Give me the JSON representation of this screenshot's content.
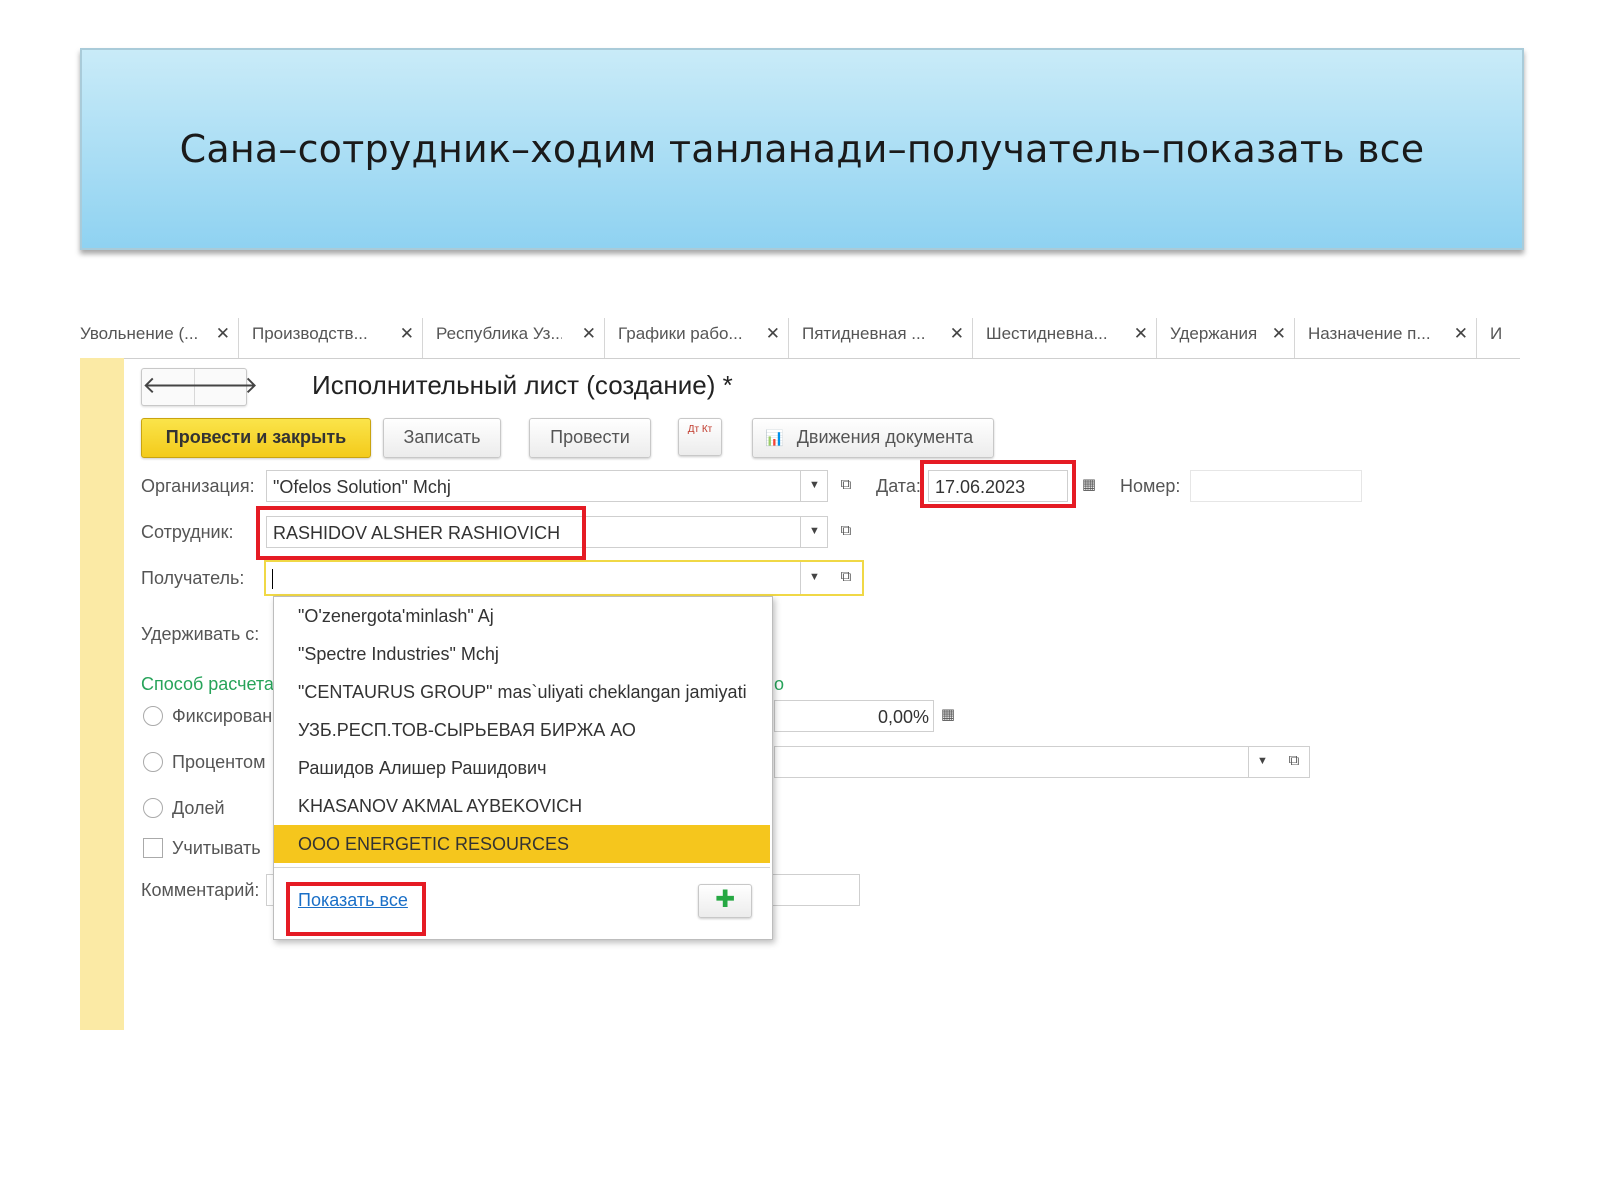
{
  "banner": {
    "text": "Сана–сотрудник–ходим танланади–получатель–показать все"
  },
  "tabs": [
    {
      "label": "Увольнение (..."
    },
    {
      "label": "Производств..."
    },
    {
      "label": "Республика Уз..."
    },
    {
      "label": "Графики рабо..."
    },
    {
      "label": "Пятидневная ..."
    },
    {
      "label": "Шестидневна..."
    },
    {
      "label": "Удержания"
    },
    {
      "label": "Назначение п..."
    },
    {
      "label": "И"
    }
  ],
  "tab_close_glyph": "✕",
  "nav": {
    "back": "🡐",
    "forward": "🡒"
  },
  "document": {
    "title": "Исполнительный лист (создание) *"
  },
  "toolbar": {
    "post_close": "Провести и закрыть",
    "save": "Записать",
    "post": "Провести",
    "dtkt": "Дт Кт",
    "movements": "Движения документа",
    "movements_icon": "📊"
  },
  "form": {
    "organization": {
      "label": "Организация:",
      "value": "\"Ofelos Solution\" Mchj"
    },
    "date": {
      "label": "Дата:",
      "value": "17.06.2023"
    },
    "number": {
      "label": "Номер:",
      "value": ""
    },
    "employee": {
      "label": "Сотрудник:",
      "value": "RASHIDOV ALSHER RASHIOVICH"
    },
    "recipient": {
      "label": "Получатель:",
      "value": ""
    },
    "withhold_from": {
      "label": "Удерживать с:"
    },
    "calc_method": {
      "label": "Способ расчета",
      "label_right": "о"
    },
    "fixed": {
      "label": "Фиксирован"
    },
    "percent_radio": {
      "label": "Процентом"
    },
    "share": {
      "label": "Долей"
    },
    "consider": {
      "label": "Учитывать"
    },
    "percent_value": "0,00%",
    "comment": {
      "label": "Комментарий:"
    }
  },
  "icons": {
    "dropdown": "▼",
    "open": "⧉",
    "calendar": "▦"
  },
  "dropdown": {
    "items": [
      {
        "label": "\"O'zenergota'minlash\" Aj"
      },
      {
        "label": "\"Spectre Industries\" Mchj"
      },
      {
        "label": "\"CENTAURUS GROUP\" mas`uliyati cheklangan jamiyati"
      },
      {
        "label": "УЗБ.РЕСП.ТОВ-СЫРЬЕВАЯ БИРЖА АО"
      },
      {
        "label": " Рашидов Алишер Рашидович"
      },
      {
        "label": "KHASANOV AKMAL AYBEKOVICH"
      },
      {
        "label": "OOO ENERGETIC RESOURCES"
      }
    ],
    "show_all": "Показать все",
    "add": "✚"
  },
  "colors": {
    "highlight": "#e51b24",
    "selected": "#f5c61d",
    "link": "#1a6fc7",
    "accent_green": "#27a35a"
  }
}
